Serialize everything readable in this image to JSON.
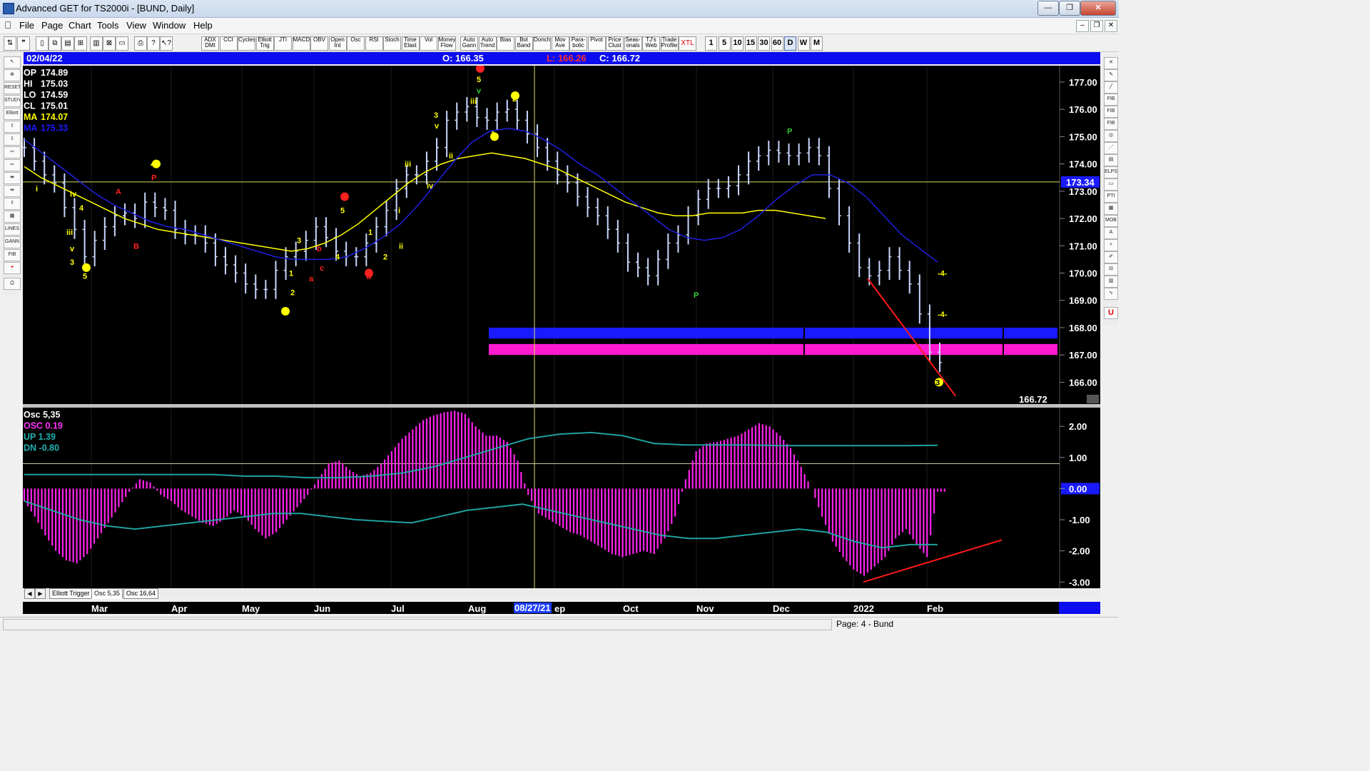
{
  "window": {
    "title": "Advanced GET for TS2000i - [BUND, Daily]",
    "minimize_label": "—",
    "restore_label": "❐",
    "close_label": "✕"
  },
  "menu": [
    "File",
    "Page",
    "Chart",
    "Tools",
    "View",
    "Window",
    "Help"
  ],
  "toolbar": {
    "study_buttons": [
      "ADX DMI",
      "CCI",
      "Cycles",
      "Elliott Trig",
      "JTI",
      "MACD",
      "OBV",
      "Open Int",
      "Osc",
      "RSI",
      "Stoch",
      "Time Elast",
      "Vol",
      "Money Flow",
      "Auto Gann",
      "Auto Trend",
      "Bias",
      "Bol Band",
      "Donch",
      "Mov Ave",
      "Para-bolic",
      "Pivot",
      "Price Clust",
      "Seas-onals",
      "TJ's Web",
      "Trade Profile",
      "XTL"
    ],
    "periodicity": [
      "1",
      "5",
      "10",
      "15",
      "30",
      "60",
      "D",
      "W",
      "M"
    ],
    "active_periodicity": "D"
  },
  "left_tools": [
    "RESET",
    "STUDY",
    "Elliott",
    "LINES",
    "GANN",
    "FIB"
  ],
  "right_tools": [
    "FIB RET",
    "FIB EXT",
    "FIB TIME",
    "ELPS",
    "PTI",
    "MOB",
    "A",
    "U"
  ],
  "info_bar": {
    "date": "02/04/22",
    "open": "O: 166.35",
    "low": "L:  166.26",
    "close": "C:  166.72"
  },
  "price_legend": [
    {
      "label": "OP",
      "value": "174.89",
      "color": "#ffffff"
    },
    {
      "label": "HI",
      "value": "175.03",
      "color": "#ffffff"
    },
    {
      "label": "LO",
      "value": "174.59",
      "color": "#ffffff"
    },
    {
      "label": "CL",
      "value": "175.01",
      "color": "#ffffff"
    },
    {
      "label": "MA",
      "value": "174.07",
      "color": "#ffff00"
    },
    {
      "label": "MA",
      "value": "175.33",
      "color": "#1a1aff"
    }
  ],
  "price_axis": {
    "ticks": [
      "177.00",
      "176.00",
      "175.00",
      "174.00",
      "173.00",
      "172.00",
      "171.00",
      "170.00",
      "169.00",
      "168.00",
      "167.00",
      "166.00"
    ],
    "cursor_price": "173.34",
    "last_price": "166.72"
  },
  "osc_legend": [
    {
      "label": "Osc 5,35",
      "color": "#ffffff"
    },
    {
      "label": "OSC 0.19",
      "color": "#ff33ff"
    },
    {
      "label": "UP   1.39",
      "color": "#20b0b0"
    },
    {
      "label": "DN   -0.80",
      "color": "#20b0b0"
    }
  ],
  "osc_axis": {
    "ticks": [
      "2.00",
      "1.00",
      "0.00",
      "-1.00",
      "-2.00",
      "-3.00"
    ],
    "zero_label": "0.00"
  },
  "tabs": [
    "Elliott Trigger",
    "Osc 5,35",
    "Osc 16,64"
  ],
  "selected_tab": "Osc 5,35",
  "time_axis": {
    "months": [
      "Mar",
      "Apr",
      "May",
      "Jun",
      "Jul",
      "Aug",
      "ep",
      "Oct",
      "Nov",
      "Dec",
      "2022",
      "Feb"
    ],
    "cursor_date": "08/27/21"
  },
  "elliott_labels": [
    "i",
    "iv",
    "iii",
    "v",
    "3",
    "4",
    "5",
    "A",
    "B",
    "4",
    "P",
    "3",
    "1",
    "2",
    "5",
    "a",
    "b",
    "c",
    "4",
    "5",
    "A",
    "B",
    "1",
    "2",
    "iii",
    "iv",
    "ii",
    "i",
    "3",
    "v",
    "ii",
    "1",
    "2",
    "C",
    "5",
    "iii",
    "v",
    "P",
    "P",
    "-4-",
    "-4-",
    "3"
  ],
  "status": {
    "page": "Page: 4 - Bund"
  },
  "chart_data": [
    {
      "type": "line",
      "title": "BUND, Daily",
      "series": [
        {
          "name": "Price",
          "values": [
            174.6,
            174.1,
            173.6,
            173.3,
            172.4,
            171.6,
            170.6,
            171.2,
            171.7,
            172.1,
            172.2,
            172.0,
            172.6,
            172.4,
            172.3,
            171.6,
            171.4,
            171.4,
            171.1,
            170.6,
            170.3,
            170.0,
            169.6,
            169.4,
            169.4,
            170.1,
            170.6,
            170.8,
            171.2,
            171.7,
            171.3,
            170.8,
            170.6,
            170.6,
            171.1,
            171.7,
            172.3,
            173.1,
            173.6,
            173.6,
            174.1,
            174.6,
            175.6,
            175.9,
            176.1,
            175.7,
            175.6,
            175.9,
            176.0,
            175.6,
            175.1,
            174.6,
            174.1,
            173.6,
            173.3,
            172.8,
            172.4,
            172.1,
            171.6,
            171.1,
            170.4,
            170.2,
            169.9,
            170.5,
            171.1,
            171.4,
            172.1,
            172.7,
            173.1,
            173.1,
            173.2,
            173.6,
            174.1,
            174.3,
            174.5,
            174.4,
            174.3,
            174.4,
            174.6,
            174.3,
            173.1,
            172.1,
            171.1,
            170.2,
            169.9,
            170.1,
            170.6,
            170.1,
            169.6,
            168.5,
            167.1,
            166.72
          ]
        },
        {
          "name": "MA",
          "values": [
            173.9,
            173.5,
            173.2,
            172.9,
            172.6,
            172.3,
            172.0,
            171.8,
            171.6,
            171.5,
            171.4,
            171.3,
            171.2,
            171.1,
            171.0,
            170.9,
            170.8,
            170.9,
            171.1,
            171.4,
            171.8,
            172.3,
            172.8,
            173.3,
            173.7,
            174.0,
            174.2,
            174.3,
            174.4,
            174.3,
            174.2,
            174.0,
            173.8,
            173.5,
            173.2,
            172.9,
            172.6,
            172.4,
            172.2,
            172.1,
            172.1,
            172.2,
            172.2,
            172.2,
            172.3,
            172.3,
            172.2,
            172.1,
            172.0
          ]
        },
        {
          "name": "MA",
          "values": [
            174.9,
            174.4,
            173.9,
            173.4,
            172.9,
            172.5,
            172.2,
            171.9,
            171.7,
            171.6,
            171.4,
            171.2,
            171.0,
            170.8,
            170.6,
            170.5,
            170.5,
            170.5,
            170.6,
            170.9,
            171.3,
            171.8,
            172.5,
            173.3,
            174.1,
            174.8,
            175.2,
            175.3,
            175.2,
            174.9,
            174.5,
            174.0,
            173.6,
            173.1,
            172.6,
            172.1,
            171.6,
            171.3,
            171.2,
            171.3,
            171.6,
            172.1,
            172.7,
            173.2,
            173.6,
            173.6,
            173.3,
            172.8,
            172.1,
            171.4,
            170.9,
            170.4
          ]
        }
      ],
      "ylim": [
        165.2,
        177.6
      ],
      "zone": {
        "blue": [
          167.6,
          168.0
        ],
        "magenta": [
          167.0,
          167.4
        ]
      },
      "horizontal_line": 173.34
    },
    {
      "type": "bar",
      "title": "Osc 5,35",
      "values": [
        -0.4,
        -0.9,
        -1.5,
        -2.0,
        -2.3,
        -2.4,
        -2.1,
        -1.6,
        -1.1,
        -0.6,
        -0.1,
        0.3,
        0.2,
        -0.2,
        -0.4,
        -0.7,
        -0.9,
        -1.1,
        -1.2,
        -1.0,
        -0.7,
        -0.9,
        -1.3,
        -1.6,
        -1.4,
        -1.0,
        -0.6,
        -0.2,
        0.3,
        0.8,
        0.9,
        0.6,
        0.4,
        0.5,
        0.8,
        1.2,
        1.6,
        1.9,
        2.2,
        2.35,
        2.45,
        2.5,
        2.4,
        2.0,
        1.7,
        1.7,
        1.5,
        0.9,
        -0.2,
        -0.8,
        -1.0,
        -1.2,
        -1.4,
        -1.5,
        -1.7,
        -1.9,
        -2.1,
        -2.2,
        -2.1,
        -2.0,
        -2.1,
        -1.6,
        -0.9,
        0.3,
        1.2,
        1.45,
        1.5,
        1.6,
        1.7,
        1.9,
        2.1,
        2.0,
        1.7,
        1.3,
        0.7,
        0.0,
        -0.9,
        -1.7,
        -2.2,
        -2.6,
        -2.8,
        -2.5,
        -2.2,
        -1.6,
        -1.3,
        -1.8,
        -2.2,
        -0.1
      ],
      "up_line": [
        0.45,
        0.45,
        0.45,
        0.45,
        0.45,
        0.45,
        0.45,
        0.4,
        0.4,
        0.35,
        0.35,
        0.4,
        0.5,
        0.7,
        1.0,
        1.3,
        1.6,
        1.75,
        1.8,
        1.7,
        1.45,
        1.4,
        1.4,
        1.4,
        1.38,
        1.38,
        1.38,
        1.38,
        1.38,
        1.39
      ],
      "dn_line": [
        -0.4,
        -0.7,
        -1.0,
        -1.2,
        -1.3,
        -1.2,
        -1.1,
        -1.0,
        -0.9,
        -0.8,
        -0.8,
        -0.9,
        -1.0,
        -1.05,
        -1.1,
        -0.9,
        -0.7,
        -0.6,
        -0.5,
        -0.7,
        -0.9,
        -1.1,
        -1.3,
        -1.5,
        -1.6,
        -1.6,
        -1.5,
        -1.4,
        -1.3,
        -1.4,
        -1.7,
        -1.9,
        -1.8,
        -1.8
      ],
      "ylim": [
        -3.2,
        2.6
      ]
    }
  ]
}
